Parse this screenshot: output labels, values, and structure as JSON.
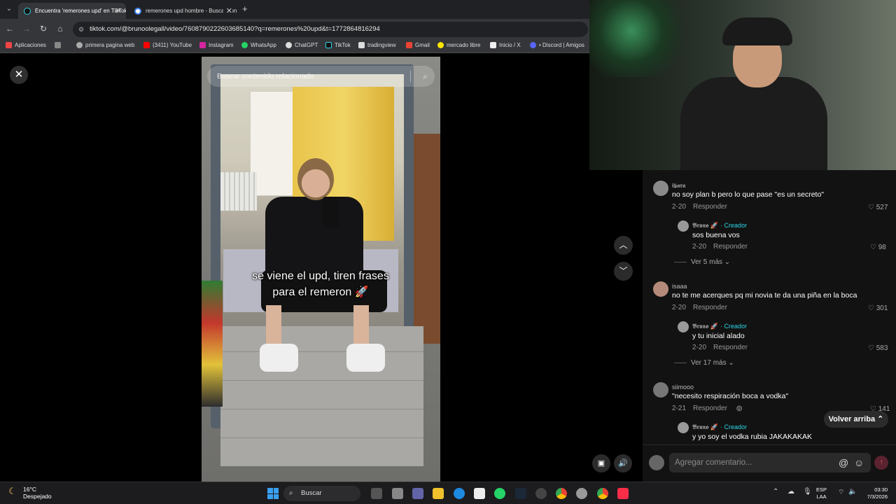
{
  "browser": {
    "tabs": [
      {
        "title": "Encuentra 'remerones upd' en TikTok",
        "active": true
      },
      {
        "title": "remerones upd hombre - Buscar con Google",
        "active": false
      }
    ],
    "url": "tiktok.com/@brunoolegall/video/7608790222603685140?q=remerones%20upd&t=1772864816294",
    "bookmarks": [
      "Aplicaciones",
      "primera pagina web",
      "(3411) YouTube",
      "Instagram",
      "WhatsApp",
      "ChatGPT",
      "TikTok",
      "tradingview",
      "Gmail",
      "mercado libre",
      "Inicio / X",
      "• Discord | Amigos"
    ]
  },
  "video": {
    "search_placeholder": "Buscar contenido relacionado",
    "caption_line1": "se viene el upd, tiren frases",
    "caption_line2": "para el remeron 🚀"
  },
  "comments": [
    {
      "user": "𝖎𝖇𝖆𝖗𝖆",
      "text": "no soy plan b pero lo que pase \"es un secreto\"",
      "date": "2-20",
      "reply": "Responder",
      "likes": "527",
      "creator_reply": {
        "user": "𝕭𝖗𝖚𝖓𝖔 🚀",
        "badge": "· Creador",
        "text": "sos buena vos",
        "date": "2-20",
        "reply": "Responder",
        "likes": "98"
      },
      "more": "Ver 5 más"
    },
    {
      "user": "isaaa",
      "text": "no te me acerques pq mi novia te da una piña en la boca",
      "date": "2-20",
      "reply": "Responder",
      "likes": "301",
      "creator_reply": {
        "user": "𝕭𝖗𝖚𝖓𝖔 🚀",
        "badge": "· Creador",
        "text": "y tu inicial alado",
        "date": "2-20",
        "reply": "Responder",
        "likes": "583"
      },
      "more": "Ver 17 más"
    },
    {
      "user": "siimooo",
      "text": "\"necesito respiración boca a vodka\"",
      "date": "2-21",
      "reply": "Responder",
      "likes": "141",
      "creator_reply": {
        "user": "𝕭𝖗𝖚𝖓𝖔 🚀",
        "badge": "· Creador",
        "text": "y yo soy el vodka rubia JAKAKAKAK"
      }
    }
  ],
  "back_to_top": "Volver arriba",
  "add_comment_placeholder": "Agregar comentario...",
  "taskbar": {
    "weather_temp": "16°C",
    "weather_desc": "Despejado",
    "search": "Buscar",
    "lang1": "ESP",
    "lang2": "LAA",
    "time": "03:30",
    "date": "7/3/2026"
  }
}
